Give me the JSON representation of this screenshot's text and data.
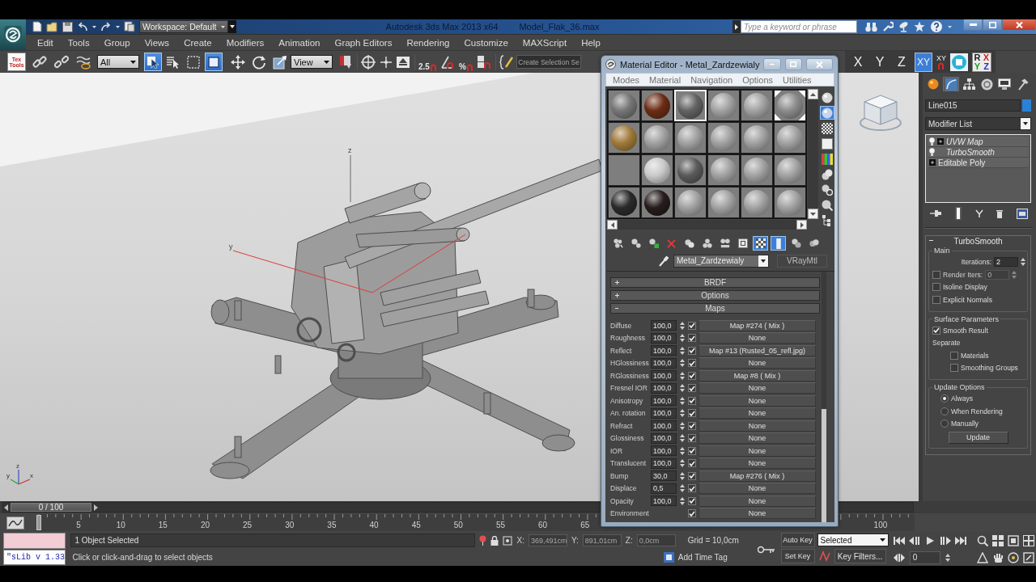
{
  "title_bar": {
    "workspace": "Workspace: Default",
    "app_title": "Autodesk 3ds Max 2013 x64",
    "file_name": "Model_Flak_36.max",
    "search": {
      "placeholder": "Type a keyword or phrase"
    }
  },
  "menu_bar": [
    "Edit",
    "Tools",
    "Group",
    "Views",
    "Create",
    "Modifiers",
    "Animation",
    "Graph Editors",
    "Rendering",
    "Customize",
    "MAXScript",
    "Help"
  ],
  "main_toolbar": {
    "texttools_label": "Tex Tools",
    "selection_filter": "All",
    "selection_tools": [
      {
        "kind": "select",
        "selected": true
      },
      {
        "kind": "by_name",
        "selected": false
      },
      {
        "kind": "region",
        "selected": false
      },
      {
        "kind": "crossing",
        "selected": true
      }
    ],
    "transform_tools": [
      {
        "kind": "move",
        "selected": false
      },
      {
        "kind": "rotate",
        "selected": false
      },
      {
        "kind": "scale",
        "selected": false
      }
    ],
    "reference_coordinate_system": "View",
    "snap_label": "2.5",
    "percent_snap_label": "%",
    "named_selection_set": "Create Selection Se",
    "axis_constraints": [
      {
        "label": "X",
        "selected": false
      },
      {
        "label": "Y",
        "selected": false
      },
      {
        "label": "Z",
        "selected": false
      },
      {
        "label": "XY",
        "selected": true
      }
    ],
    "constraint_snap_label": "XY",
    "axis_letters": [
      {
        "letter": "R",
        "color": "#1a1a1a"
      },
      {
        "letter": "X",
        "color": "#d42020"
      },
      {
        "letter": "Y",
        "color": "#1e9a1e"
      },
      {
        "letter": "Z",
        "color": "#2232c8"
      }
    ]
  },
  "viewport": {
    "gizmo_labels": [
      "z",
      "y"
    ],
    "tripod_labels": [
      "z",
      "y",
      "x"
    ]
  },
  "material_editor": {
    "title": "Material Editor - Metal_Zardzewialy",
    "menu": [
      "Modes",
      "Material",
      "Navigation",
      "Options",
      "Utilities"
    ],
    "slots": [
      {
        "kind": "sphere",
        "color": "#767676",
        "selected": false,
        "hot": false
      },
      {
        "kind": "sphere",
        "color": "#6a2c14",
        "selected": false,
        "hot": false
      },
      {
        "kind": "sphere",
        "color": "#626262",
        "selected": true,
        "hot": false
      },
      {
        "kind": "sphere",
        "color": "#a2a2a2",
        "selected": false,
        "hot": false
      },
      {
        "kind": "sphere",
        "color": "#a2a2a2",
        "selected": false,
        "hot": false
      },
      {
        "kind": "sphere",
        "color": "#8c8c8c",
        "selected": false,
        "hot": true
      },
      {
        "kind": "sphere",
        "color": "#a07a38",
        "selected": false,
        "hot": false
      },
      {
        "kind": "sphere",
        "color": "#a2a2a2",
        "selected": false,
        "hot": false
      },
      {
        "kind": "sphere",
        "color": "#a2a2a2",
        "selected": false,
        "hot": false
      },
      {
        "kind": "sphere",
        "color": "#a2a2a2",
        "selected": false,
        "hot": false
      },
      {
        "kind": "sphere",
        "color": "#a2a2a2",
        "selected": false,
        "hot": false
      },
      {
        "kind": "sphere",
        "color": "#a2a2a2",
        "selected": false,
        "hot": false
      },
      {
        "kind": "empty",
        "selected": false,
        "hot": false
      },
      {
        "kind": "sphere",
        "color": "#cacaca",
        "selected": false,
        "hot": false
      },
      {
        "kind": "sphere",
        "color": "#5a5a5a",
        "selected": false,
        "hot": false
      },
      {
        "kind": "sphere",
        "color": "#a2a2a2",
        "selected": false,
        "hot": false
      },
      {
        "kind": "sphere",
        "color": "#a2a2a2",
        "selected": false,
        "hot": false
      },
      {
        "kind": "sphere",
        "color": "#a2a2a2",
        "selected": false,
        "hot": false
      },
      {
        "kind": "sphere",
        "color": "#2a2a2a",
        "selected": false,
        "hot": false
      },
      {
        "kind": "sphere",
        "color": "#261c1c",
        "selected": false,
        "hot": false
      },
      {
        "kind": "sphere",
        "color": "#a2a2a2",
        "selected": false,
        "hot": false
      },
      {
        "kind": "sphere",
        "color": "#a2a2a2",
        "selected": false,
        "hot": false
      },
      {
        "kind": "sphere",
        "color": "#a2a2a2",
        "selected": false,
        "hot": false
      },
      {
        "kind": "sphere",
        "color": "#a2a2a2",
        "selected": false,
        "hot": false
      }
    ],
    "side_toolbar": [
      {
        "kind": "sample_type",
        "selected": false
      },
      {
        "kind": "backlight",
        "selected": true
      },
      {
        "kind": "background",
        "selected": false
      },
      {
        "kind": "uv_tiling",
        "selected": false
      },
      {
        "kind": "video_check",
        "selected": false
      },
      {
        "kind": "preview",
        "selected": false
      },
      {
        "kind": "options",
        "selected": false
      },
      {
        "kind": "select_by_material",
        "selected": false
      },
      {
        "kind": "navigator",
        "selected": false
      }
    ],
    "toolbar": [
      {
        "kind": "get",
        "selected": false
      },
      {
        "kind": "put",
        "selected": false
      },
      {
        "kind": "assign",
        "selected": false
      },
      {
        "kind": "reset",
        "selected": false
      },
      {
        "kind": "copy",
        "selected": false
      },
      {
        "kind": "unique",
        "selected": false
      },
      {
        "kind": "library",
        "selected": false
      },
      {
        "kind": "material_id",
        "selected": false
      },
      {
        "kind": "show_map",
        "selected": true
      },
      {
        "kind": "end_result",
        "selected": true
      },
      {
        "kind": "parent",
        "selected": false
      },
      {
        "kind": "sibling",
        "selected": false
      }
    ],
    "material_name": "Metal_Zardzewialy",
    "material_type": "VRayMtl",
    "rollouts": [
      {
        "title": "BRDF",
        "expanded": false
      },
      {
        "title": "Options",
        "expanded": false
      },
      {
        "title": "Maps",
        "expanded": true,
        "rows": [
          {
            "name": "Diffuse",
            "amount": "100,0",
            "checked": true,
            "map": "Map #274 ( Mix )"
          },
          {
            "name": "Roughness",
            "amount": "100,0",
            "checked": true,
            "map": "None"
          },
          {
            "name": "Reflect",
            "amount": "100,0",
            "checked": true,
            "map": "Map #13 (Rusted_05_refl.jpg)"
          },
          {
            "name": "HGlossiness",
            "amount": "100,0",
            "checked": true,
            "map": "None"
          },
          {
            "name": "RGlossiness",
            "amount": "100,0",
            "checked": true,
            "map": "Map #8 ( Mix )"
          },
          {
            "name": "Fresnel IOR",
            "amount": "100,0",
            "checked": true,
            "map": "None"
          },
          {
            "name": "Anisotropy",
            "amount": "100,0",
            "checked": true,
            "map": "None"
          },
          {
            "name": "An. rotation",
            "amount": "100,0",
            "checked": true,
            "map": "None"
          },
          {
            "name": "Refract",
            "amount": "100,0",
            "checked": true,
            "map": "None"
          },
          {
            "name": "Glossiness",
            "amount": "100,0",
            "checked": true,
            "map": "None"
          },
          {
            "name": "IOR",
            "amount": "100,0",
            "checked": true,
            "map": "None"
          },
          {
            "name": "Translucent",
            "amount": "100,0",
            "checked": true,
            "map": "None"
          },
          {
            "name": "Bump",
            "amount": "30,0",
            "checked": true,
            "map": "Map #276 ( Mix )"
          },
          {
            "name": "Displace",
            "amount": "0,5",
            "checked": true,
            "map": "None"
          },
          {
            "name": "Opacity",
            "amount": "100,0",
            "checked": true,
            "map": "None"
          },
          {
            "name": "Environment",
            "checked": true,
            "map": "None"
          }
        ]
      }
    ]
  },
  "command_panel": {
    "tabs": [
      {
        "kind": "create",
        "selected": false
      },
      {
        "kind": "modify",
        "selected": true
      },
      {
        "kind": "hierarchy",
        "selected": false
      },
      {
        "kind": "motion",
        "selected": false
      },
      {
        "kind": "display",
        "selected": false
      },
      {
        "kind": "utilities",
        "selected": false
      }
    ],
    "object_name": "Line015",
    "modifier_list": "Modifier List",
    "modifier_stack": [
      {
        "name": "UVW Map",
        "kind": "modifier",
        "instanced": true,
        "expandable": true
      },
      {
        "name": "TurboSmooth",
        "kind": "modifier",
        "instanced": true,
        "expandable": false
      },
      {
        "name": "Editable Poly",
        "kind": "base",
        "instanced": false,
        "expandable": true
      }
    ],
    "rollout": {
      "title": "TurboSmooth",
      "expanded": true,
      "groups": [
        {
          "title": "Main",
          "items": [
            {
              "kind": "spinner",
              "label": "Iterations:",
              "value": "2"
            },
            {
              "kind": "checked_spinner",
              "label": "Render Iters:",
              "value": "0",
              "checked": false
            },
            {
              "kind": "checkbox",
              "label": "Isoline Display",
              "checked": false
            },
            {
              "kind": "checkbox",
              "label": "Explicit Normals",
              "checked": false
            }
          ]
        },
        {
          "title": "Surface Parameters",
          "items": [
            {
              "kind": "checkbox",
              "label": "Smooth Result",
              "checked": true
            },
            {
              "kind": "label",
              "label": "Separate",
              "children": [
                {
                  "kind": "checkbox",
                  "label": "Materials",
                  "checked": false
                },
                {
                  "kind": "checkbox",
                  "label": "Smoothing Groups",
                  "checked": false
                }
              ]
            }
          ]
        },
        {
          "title": "Update Options",
          "items": [
            {
              "kind": "radio",
              "label": "Always",
              "selected": true
            },
            {
              "kind": "radio",
              "label": "When Rendering",
              "selected": false
            },
            {
              "kind": "radio",
              "label": "Manually",
              "selected": false
            },
            {
              "kind": "button",
              "label": "Update"
            }
          ]
        }
      ]
    }
  },
  "timeline": {
    "slider": {
      "label": "0 / 100",
      "level": 0
    },
    "ruler_labels": [
      "5",
      "10",
      "15",
      "20",
      "25",
      "30",
      "35",
      "40",
      "45",
      "50",
      "55",
      "60",
      "65"
    ],
    "end_label": "100"
  },
  "status_bar": {
    "listener_output": "\"sLib v 1.33",
    "selection_info": "1 Object Selected",
    "prompt": "Click or click-and-drag to select objects",
    "coordinates": [
      {
        "axis": "X:",
        "value": "369,491cm"
      },
      {
        "axis": "Y:",
        "value": "891,01cm"
      },
      {
        "axis": "Z:",
        "value": "0,0cm"
      }
    ],
    "grid": "Grid = 10,0cm",
    "time_tag": "Add Time Tag",
    "auto_key": {
      "label": "Auto Key",
      "on": false
    },
    "key_set": "Selected",
    "set_key": "Set Key",
    "key_filters": "Key Filters...",
    "current_frame": "0"
  }
}
